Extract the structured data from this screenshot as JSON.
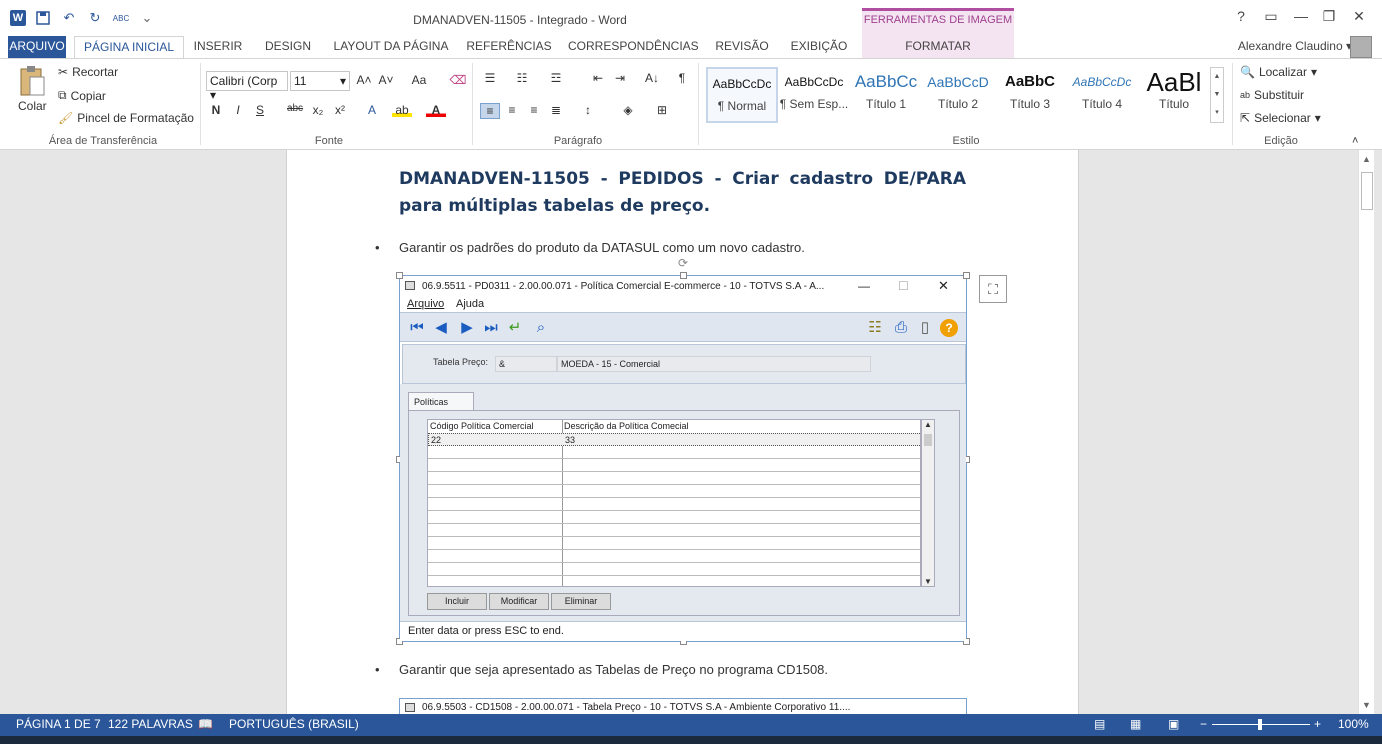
{
  "window": {
    "title": "DMANADVEN-11505 - Integrado - Word",
    "context_tab_header": "FERRAMENTAS DE IMAGEM",
    "help": "?",
    "controls": [
      "▭",
      "—",
      "❐",
      "✕"
    ]
  },
  "qat": {
    "undo": "↶",
    "redo": "↻",
    "spell": "ABC",
    "more": "⌄"
  },
  "tabs": [
    "ARQUIVO",
    "PÁGINA INICIAL",
    "INSERIR",
    "DESIGN",
    "LAYOUT DA PÁGINA",
    "REFERÊNCIAS",
    "CORRESPONDÊNCIAS",
    "REVISÃO",
    "EXIBIÇÃO",
    "FORMATAR"
  ],
  "user": "Alexandre Claudino",
  "ribbon": {
    "clipboard": {
      "paste": "Colar",
      "cut": "Recortar",
      "copy": "Copiar",
      "format_painter": "Pincel de Formatação",
      "label": "Área de Transferência"
    },
    "font": {
      "name": "Calibri (Corp",
      "size": "11",
      "label": "Fonte",
      "bold": "N",
      "italic": "I",
      "underline": "S",
      "strike": "abc",
      "sub": "x₂",
      "sup": "x²",
      "grow": "A˄",
      "shrink": "A˅",
      "case": "Aa",
      "clear": "⌫"
    },
    "paragraph": {
      "label": "Parágrafo",
      "pilcrow": "¶",
      "sort": "A↓"
    },
    "styles": {
      "label": "Estilo",
      "items": [
        {
          "preview": "AaBbCcDc",
          "name": "¶ Normal"
        },
        {
          "preview": "AaBbCcDc",
          "name": "¶ Sem Esp..."
        },
        {
          "preview": "AaBbCc",
          "name": "Título 1"
        },
        {
          "preview": "AaBbCcD",
          "name": "Título 2"
        },
        {
          "preview": "AaBbC",
          "name": "Título 3"
        },
        {
          "preview": "AaBbCcDc",
          "name": "Título 4"
        },
        {
          "preview": "AaBl",
          "name": "Título"
        }
      ]
    },
    "editing": {
      "find": "Localizar",
      "replace": "Substituir",
      "select": "Selecionar",
      "label": "Edição"
    }
  },
  "document": {
    "heading": "DMANADVEN-11505 - PEDIDOS - Criar cadastro DE/PARA para múltiplas tabelas de preço.",
    "bullets": [
      "Garantir os padrões do produto da DATASUL como um novo cadastro.",
      "Garantir que seja apresentado as Tabelas de Preço no programa CD1508."
    ],
    "bullet_char": "•",
    "embedded_app": {
      "title": "06.9.5511 - PD0311 - 2.00.00.071 - Política Comercial E-commerce - 10 - TOTVS S.A - A...",
      "menu": [
        "Arquivo",
        "Ajuda"
      ],
      "form_label": "Tabela Preço:",
      "field_code": "&",
      "field_desc": "MOEDA - 15 - Comercial",
      "tab": "Políticas",
      "columns": [
        "Código Política Comercial",
        "Descrição da Política Comecial"
      ],
      "rows": [
        [
          "22",
          "33"
        ]
      ],
      "buttons": [
        "Incluir",
        "Modificar",
        "Eliminar"
      ],
      "status": "Enter data or press ESC to end."
    },
    "embedded_app2_title": "06.9.5503 - CD1508 - 2.00.00.071 - Tabela Preço - 10 - TOTVS S.A - Ambiente Corporativo 11...."
  },
  "status": {
    "page": "PÁGINA 1 DE 7",
    "words": "122 PALAVRAS",
    "language": "PORTUGUÊS (BRASIL)",
    "zoom": "100%"
  }
}
